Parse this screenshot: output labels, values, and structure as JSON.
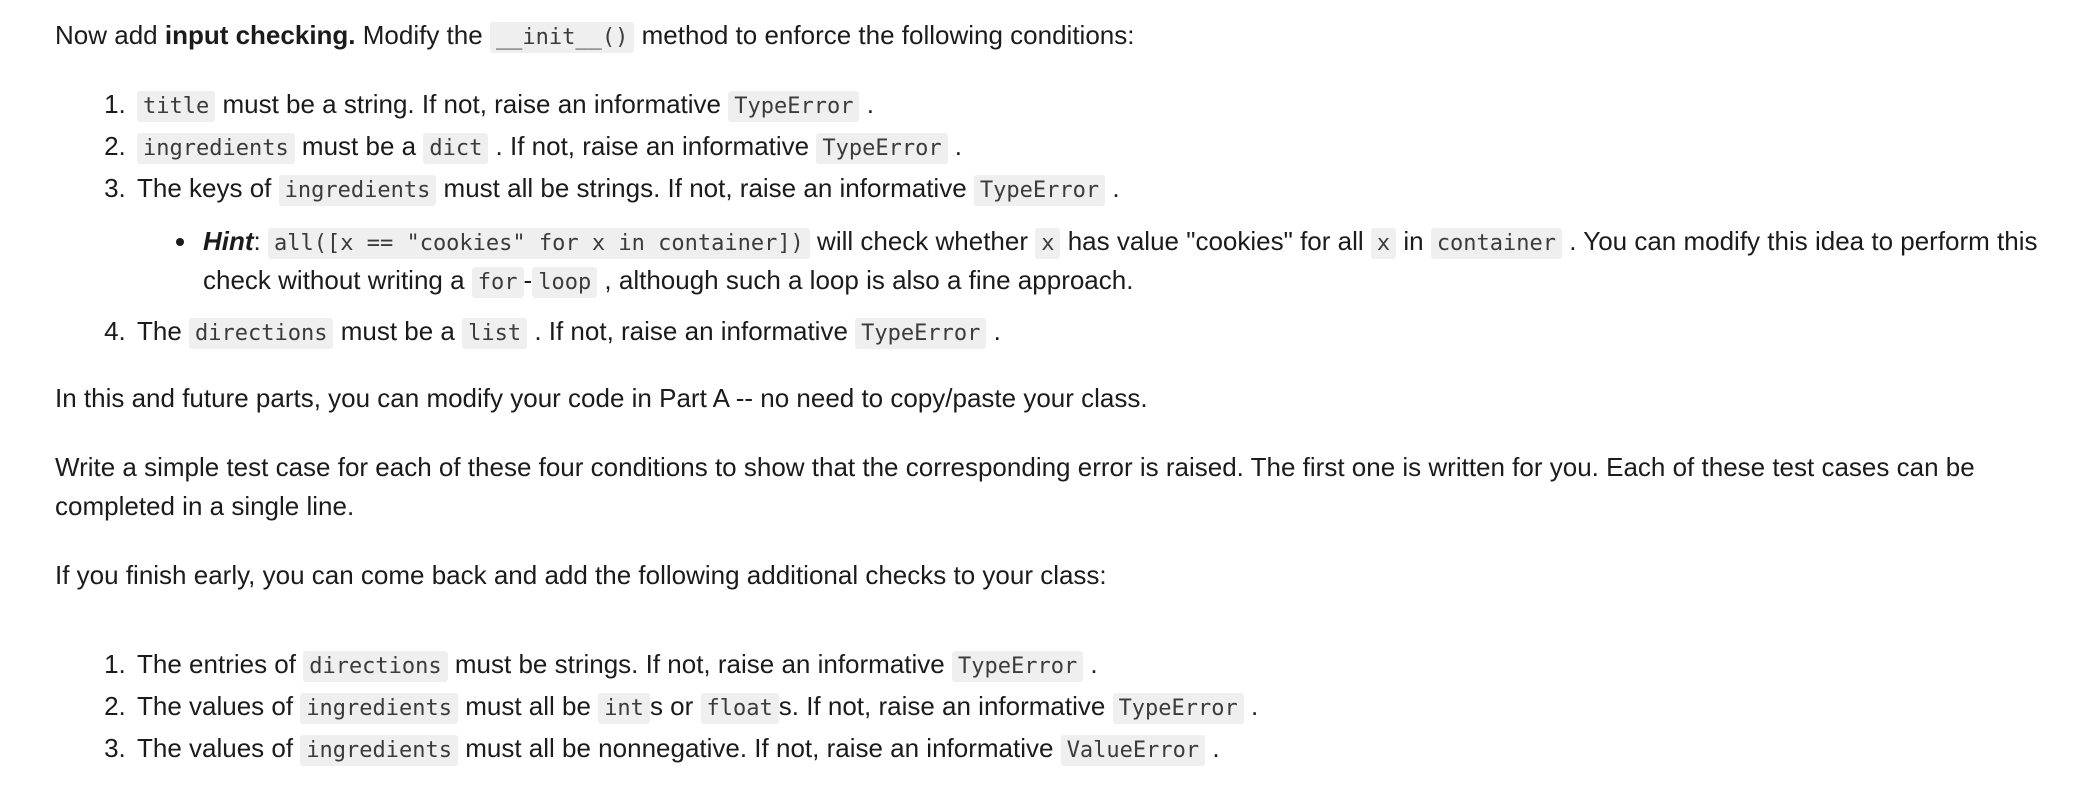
{
  "intro": {
    "prefix": "Now add ",
    "bold": "input checking.",
    "middle": " Modify the ",
    "code_init": "__init__()",
    "suffix": " method to enforce the following conditions:"
  },
  "conditions": {
    "item1": {
      "code_title": "title",
      "text_a": " must be a string. If not, raise an informative ",
      "code_error": "TypeError",
      "text_b": " ."
    },
    "item2": {
      "code_ingredients": "ingredients",
      "text_a": " must be a ",
      "code_dict": "dict",
      "text_b": " . If not, raise an informative ",
      "code_error": "TypeError",
      "text_c": " ."
    },
    "item3": {
      "text_a": "The keys of ",
      "code_ingredients": "ingredients",
      "text_b": " must all be strings. If not, raise an informative ",
      "code_error": "TypeError",
      "text_c": " ."
    },
    "hint": {
      "label": "Hint",
      "colon": ": ",
      "code_all": "all([x == \"cookies\" for x in container])",
      "text_a": " will check whether ",
      "code_x1": "x",
      "text_b": " has value \"cookies\" for all ",
      "code_x2": "x",
      "text_c": " in ",
      "code_container": "container",
      "text_d": " . You can modify this idea to perform this check without writing a ",
      "code_for": "for",
      "hyphen": "-",
      "code_loop": "loop",
      "text_e": " , although such a loop is also a fine approach."
    },
    "item4": {
      "text_a": "The ",
      "code_directions": "directions",
      "text_b": " must be a ",
      "code_list": "list",
      "text_c": " . If not, raise an informative ",
      "code_error": "TypeError",
      "text_d": " ."
    }
  },
  "paragraphs": {
    "modify_note": "In this and future parts, you can modify your code in Part A -- no need to copy/paste your class.",
    "test_cases": "Write a simple test case for each of these four conditions to show that the corresponding error is raised. The first one is written for you. Each of these test cases can be completed in a single line.",
    "finish_early": "If you finish early, you can come back and add the following additional checks to your class:"
  },
  "extra_checks": {
    "item1": {
      "text_a": "The entries of ",
      "code_directions": "directions",
      "text_b": " must be strings. If not, raise an informative ",
      "code_error": "TypeError",
      "text_c": " ."
    },
    "item2": {
      "text_a": "The values of ",
      "code_ingredients": "ingredients",
      "text_b": " must all be ",
      "code_int": "int",
      "text_c": "s or ",
      "code_float": "float",
      "text_d": "s. If not, raise an informative ",
      "code_error": "TypeError",
      "text_e": " ."
    },
    "item3": {
      "text_a": "The values of ",
      "code_ingredients": "ingredients",
      "text_b": " must all be nonnegative. If not, raise an informative ",
      "code_error": "ValueError",
      "text_c": " ."
    }
  },
  "colors": {
    "text": "#1b1b1b",
    "code_bg": "#efefef",
    "code_text": "#3b3b3b",
    "page_bg": "#ffffff"
  }
}
